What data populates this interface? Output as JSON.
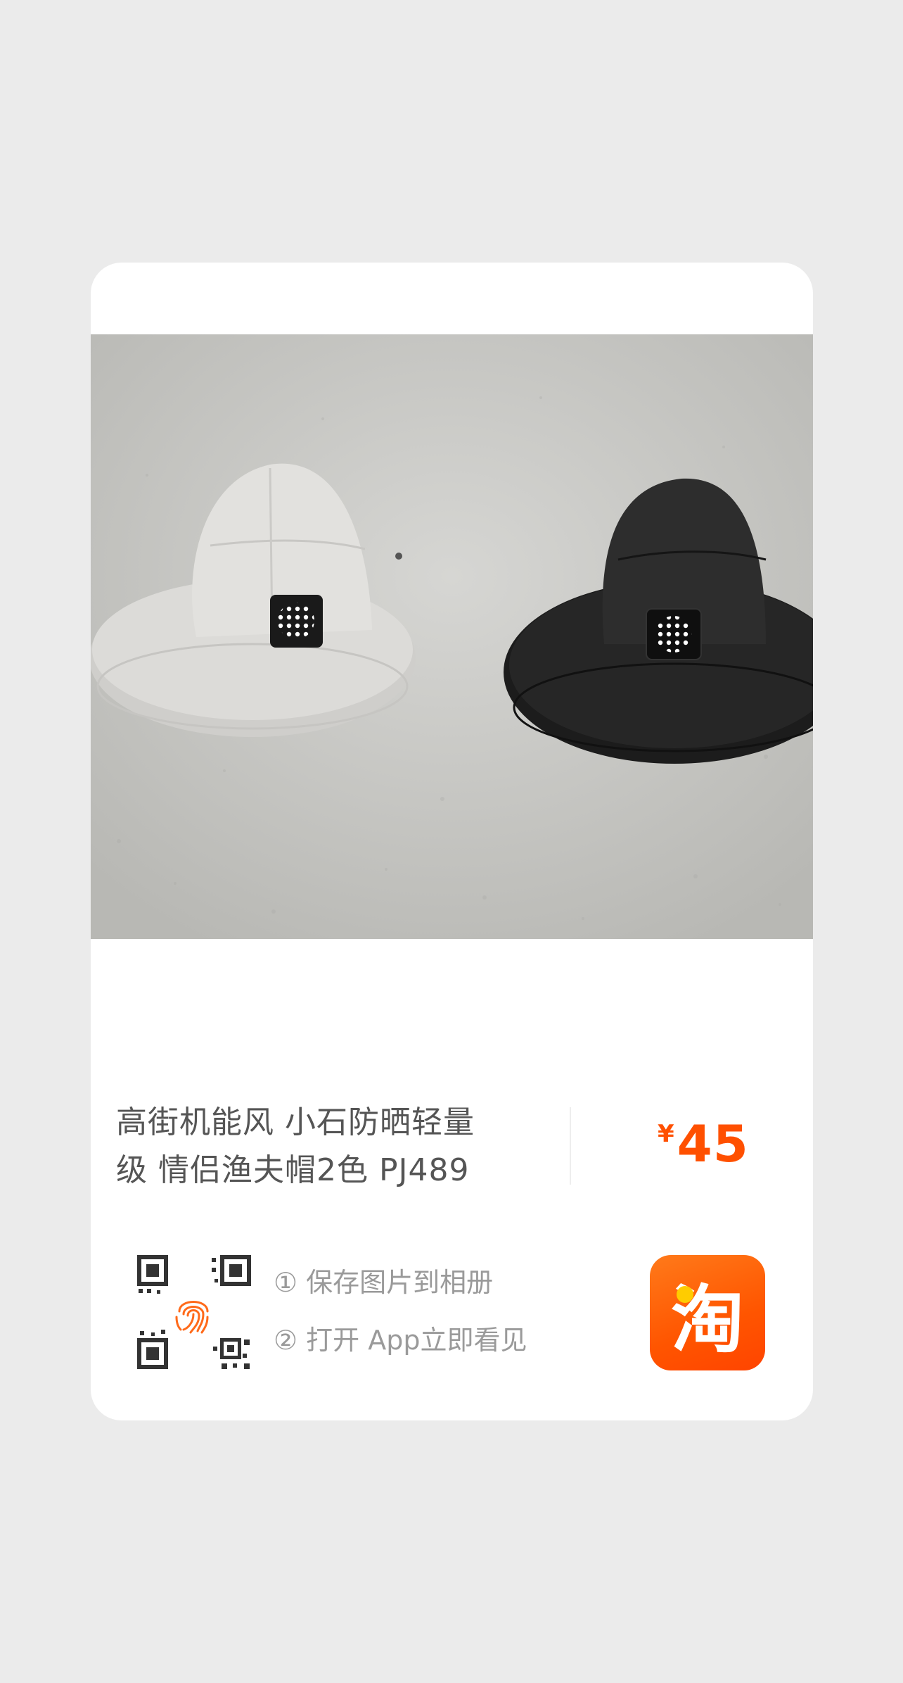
{
  "product": {
    "title_line1": "高街机能风 小石防晒轻量",
    "title_line2": "级 情侣渔夫帽2色 PJ489",
    "currency": "¥",
    "price": "45"
  },
  "steps": {
    "step1": "① 保存图片到相册",
    "step2": "② 打开 App立即看见"
  },
  "app": {
    "logo_char": "淘",
    "logo_color": "#ff5000"
  },
  "icons": [
    "qr-code-icon",
    "fingerprint-icon",
    "taobao-logo-icon"
  ],
  "colors": {
    "price": "#ff5000",
    "background": "#ebebeb",
    "card": "#ffffff",
    "title_text": "#555555",
    "step_text": "#9a9a9a"
  }
}
